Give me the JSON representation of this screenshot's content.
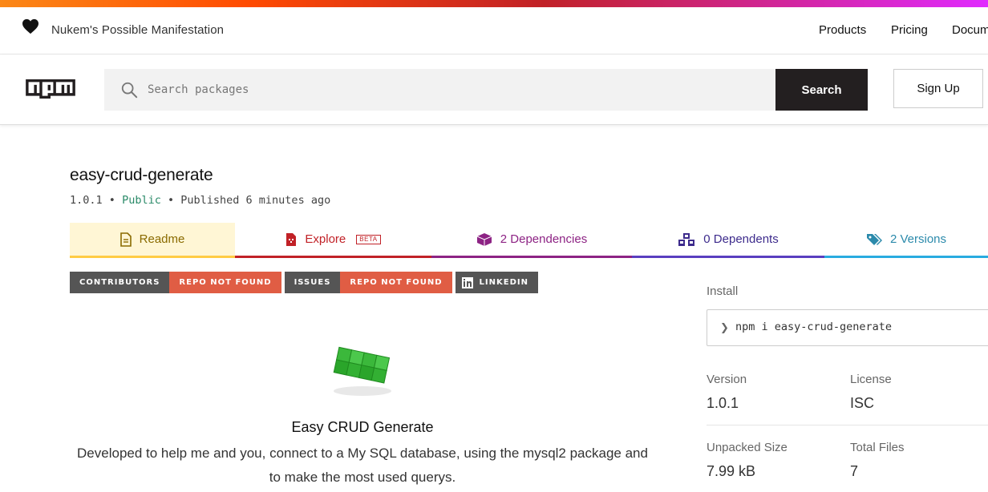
{
  "header": {
    "site_name": "Nukem's Possible Manifestation",
    "nav": [
      "Products",
      "Pricing",
      "Documentation"
    ]
  },
  "search": {
    "placeholder": "Search packages",
    "button_label": "Search",
    "signup_label": "Sign Up"
  },
  "package": {
    "name": "easy-crud-generate",
    "version": "1.0.1",
    "visibility": "Public",
    "published": "Published 6 minutes ago"
  },
  "tabs": {
    "readme": "Readme",
    "explore": "Explore",
    "explore_badge": "BETA",
    "dependencies": "2 Dependencies",
    "dependents": "0 Dependents",
    "versions": "2 Versions"
  },
  "badges": [
    {
      "label": "CONTRIBUTORS",
      "value": "REPO NOT FOUND"
    },
    {
      "label": "ISSUES",
      "value": "REPO NOT FOUND"
    },
    {
      "label": "LINKEDIN"
    }
  ],
  "readme": {
    "heading": "Easy CRUD Generate",
    "description": "Developed to help me and you, connect to a My SQL database, using the mysql2 package and to make the most used querys."
  },
  "sidebar": {
    "install_label": "Install",
    "install_command": "npm i easy-crud-generate",
    "version_label": "Version",
    "version_value": "1.0.1",
    "license_label": "License",
    "license_value": "ISC",
    "unpacked_label": "Unpacked Size",
    "unpacked_value": "7.99 kB",
    "files_label": "Total Files",
    "files_value": "7"
  },
  "colors": {
    "accent_readme": "#ffcc44",
    "accent_explore": "#c12127",
    "accent_deps": "#8d2384",
    "accent_dependents": "#5a3fc0",
    "accent_versions": "#29abe0"
  }
}
